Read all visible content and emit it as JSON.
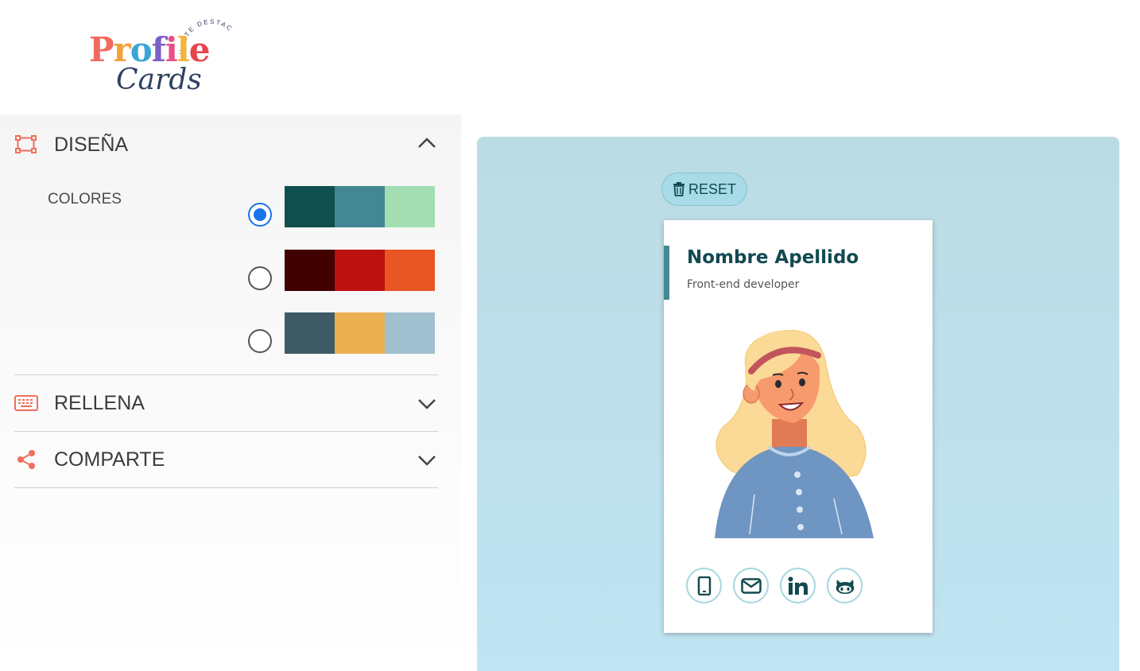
{
  "header": {
    "logo_word": "Profile",
    "logo_script": "Cards",
    "logo_arc": "HAZTE DESTACAR!",
    "logo_colors": [
      "#f06a5e",
      "#f0a23a",
      "#3aa6d6",
      "#7b5fc9",
      "#e94f86",
      "#f3b43c",
      "#e6454c"
    ]
  },
  "design_section": {
    "title": "DISEÑA",
    "icon": "design-icon",
    "expanded": true,
    "colores_label": "COLORES",
    "palettes": [
      {
        "selected": true,
        "colors": [
          "#114e4e",
          "#438792",
          "#a2deb2"
        ]
      },
      {
        "selected": false,
        "colors": [
          "#420101",
          "#bd1010",
          "#e95626"
        ]
      },
      {
        "selected": false,
        "colors": [
          "#3e5b65",
          "#eab052",
          "#a0c0cf"
        ]
      }
    ]
  },
  "fill_section": {
    "title": "RELLENA",
    "icon": "keyboard-icon"
  },
  "share_section": {
    "title": "COMPARTE",
    "icon": "share-icon"
  },
  "preview": {
    "reset_label": "RESET",
    "card": {
      "name": "Nombre Apellido",
      "job": "Front-end developer",
      "accent": "#438892",
      "title_color": "#124a50"
    },
    "social": [
      {
        "name": "phone-icon"
      },
      {
        "name": "email-icon"
      },
      {
        "name": "linkedin-icon"
      },
      {
        "name": "github-icon"
      }
    ]
  }
}
